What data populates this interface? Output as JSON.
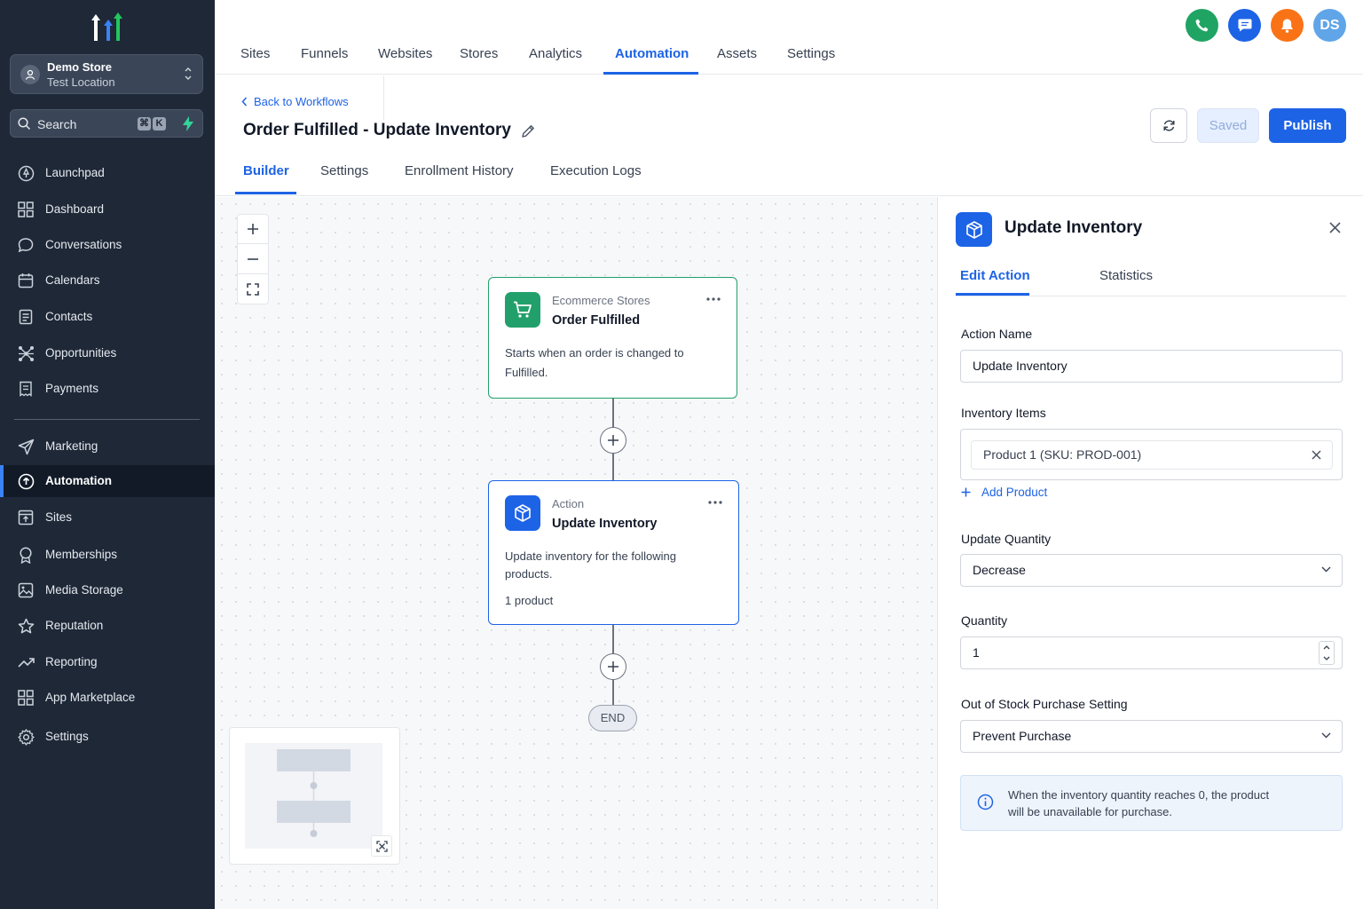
{
  "sidebar": {
    "store_name": "Demo Store",
    "store_location": "Test Location",
    "search_label": "Search",
    "search_shortcut": [
      "⌘",
      "K"
    ],
    "items": [
      {
        "label": "Launchpad",
        "icon": "launchpad-icon"
      },
      {
        "label": "Dashboard",
        "icon": "dashboard-icon"
      },
      {
        "label": "Conversations",
        "icon": "chat-icon"
      },
      {
        "label": "Calendars",
        "icon": "calendar-icon"
      },
      {
        "label": "Contacts",
        "icon": "contacts-icon"
      },
      {
        "label": "Opportunities",
        "icon": "opportunities-icon"
      },
      {
        "label": "Payments",
        "icon": "payments-icon"
      },
      {
        "label": "Marketing",
        "icon": "send-icon"
      },
      {
        "label": "Automation",
        "icon": "automation-icon",
        "active": true
      },
      {
        "label": "Sites",
        "icon": "sites-icon"
      },
      {
        "label": "Memberships",
        "icon": "memberships-icon"
      },
      {
        "label": "Media Storage",
        "icon": "image-icon"
      },
      {
        "label": "Reputation",
        "icon": "star-icon"
      },
      {
        "label": "Reporting",
        "icon": "trend-icon"
      },
      {
        "label": "App Marketplace",
        "icon": "apps-icon"
      },
      {
        "label": "Settings",
        "icon": "gear-icon"
      }
    ]
  },
  "topnav": {
    "tabs": [
      "Sites",
      "Funnels",
      "Websites",
      "Stores",
      "Analytics",
      "Automation",
      "Assets",
      "Settings"
    ],
    "active_tab": "Automation",
    "user_initials": "DS"
  },
  "header": {
    "back_label": "Back to Workflows",
    "title": "Order Fulfilled - Update Inventory",
    "tabs": [
      "Builder",
      "Settings",
      "Enrollment History",
      "Execution Logs"
    ],
    "active_tab": "Builder",
    "saved_label": "Saved",
    "publish_label": "Publish"
  },
  "canvas": {
    "trigger": {
      "category": "Ecommerce Stores",
      "name": "Order Fulfilled",
      "description": "Starts when an order is changed to Fulfilled."
    },
    "action": {
      "category": "Action",
      "name": "Update Inventory",
      "description": "Update inventory for the following products.",
      "count": "1 product"
    },
    "end_label": "END"
  },
  "panel": {
    "title": "Update Inventory",
    "tabs": [
      "Edit Action",
      "Statistics"
    ],
    "active_tab": "Edit Action",
    "action_name_label": "Action Name",
    "action_name_value": "Update Inventory",
    "inventory_label": "Inventory Items",
    "inventory_item": "Product 1 (SKU: PROD-001)",
    "add_product_label": "Add Product",
    "update_quantity_label": "Update Quantity",
    "update_quantity_value": "Decrease",
    "quantity_label": "Quantity",
    "quantity_value": "1",
    "oos_label": "Out of Stock Purchase Setting",
    "oos_value": "Prevent Purchase",
    "info_text": "When the inventory quantity reaches 0, the product will be unavailable for purchase."
  },
  "colors": {
    "sidebar_bg": "#1e2837",
    "accent": "#1d63e6",
    "trigger_green": "#22a06b",
    "phone_green": "#1fa463",
    "notify_orange": "#f97316"
  }
}
